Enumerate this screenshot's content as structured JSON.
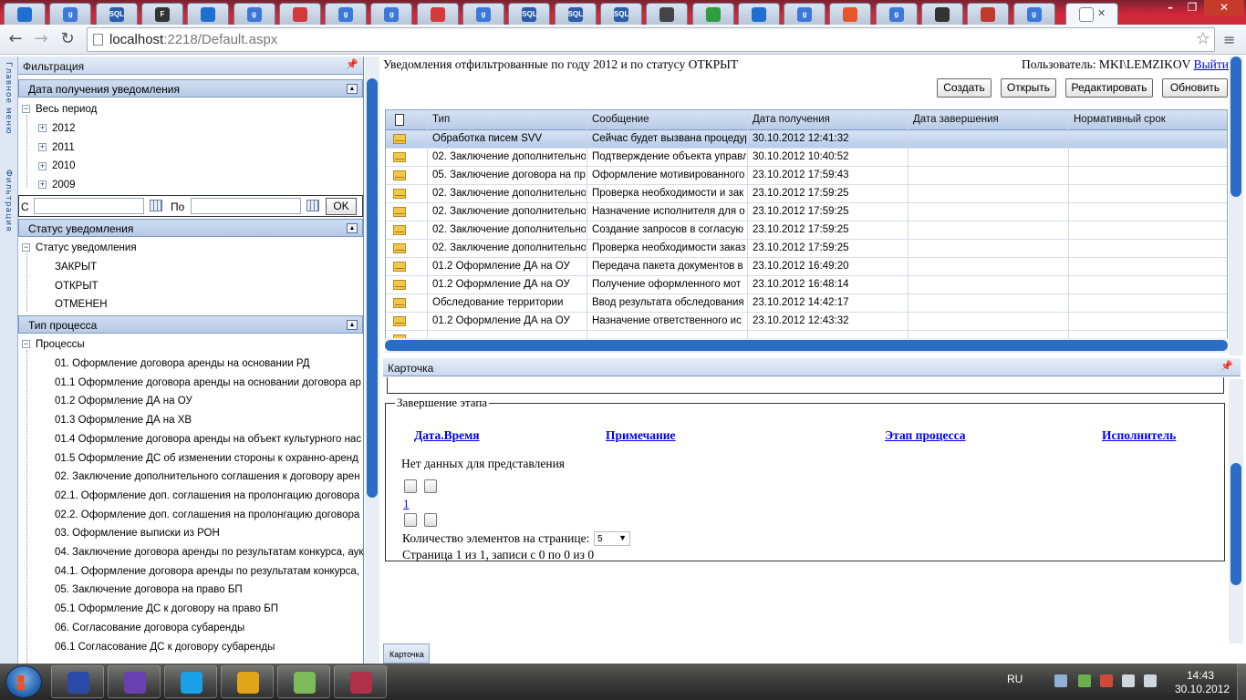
{
  "browser": {
    "tab_favicons": [
      {
        "icon": "app-icon",
        "color": "#1e6fd0",
        "label": ""
      },
      {
        "icon": "google-icon",
        "color": "#3c78d8",
        "label": "g"
      },
      {
        "icon": "sql-icon",
        "color": "#2a5ea8",
        "label": "SQL"
      },
      {
        "icon": "f-icon",
        "color": "#333333",
        "label": "F"
      },
      {
        "icon": "app-icon",
        "color": "#1e6fd0",
        "label": ""
      },
      {
        "icon": "google-icon",
        "color": "#3c78d8",
        "label": "g"
      },
      {
        "icon": "app-icon",
        "color": "#d43a3a",
        "label": ""
      },
      {
        "icon": "google-icon",
        "color": "#3c78d8",
        "label": "g"
      },
      {
        "icon": "google-icon",
        "color": "#3c78d8",
        "label": "g"
      },
      {
        "icon": "app-icon",
        "color": "#d43a3a",
        "label": ""
      },
      {
        "icon": "google-icon",
        "color": "#3c78d8",
        "label": "g"
      },
      {
        "icon": "sql-icon",
        "color": "#2a5ea8",
        "label": "SQL"
      },
      {
        "icon": "sql-icon",
        "color": "#2a5ea8",
        "label": "SQL"
      },
      {
        "icon": "sql-icon",
        "color": "#2a5ea8",
        "label": "SQL"
      },
      {
        "icon": "app-icon",
        "color": "#444444",
        "label": ""
      },
      {
        "icon": "app-icon",
        "color": "#2e9e3e",
        "label": ""
      },
      {
        "icon": "app-icon",
        "color": "#1e6fd0",
        "label": ""
      },
      {
        "icon": "google-icon",
        "color": "#3c78d8",
        "label": "g"
      },
      {
        "icon": "windows-icon",
        "color": "#e8542b",
        "label": ""
      },
      {
        "icon": "google-icon",
        "color": "#3c78d8",
        "label": "g"
      },
      {
        "icon": "app-icon",
        "color": "#333333",
        "label": ""
      },
      {
        "icon": "app-icon",
        "color": "#c0392b",
        "label": ""
      },
      {
        "icon": "google-icon",
        "color": "#3c78d8",
        "label": "g"
      },
      {
        "icon": "page-icon",
        "color": "#ffffff",
        "label": ""
      }
    ],
    "url_host": "localhost",
    "url_rest": ":2218/Default.aspx"
  },
  "sidebar_strip": {
    "main_menu": "Главное меню",
    "filtration": "Фильтрация"
  },
  "left": {
    "title": "Фильтрация",
    "date_group": {
      "title": "Дата получения уведомления",
      "root": "Весь период",
      "years": [
        "2012",
        "2011",
        "2010",
        "2009"
      ],
      "from_label": "С",
      "to_label": "По",
      "ok_label": "OK"
    },
    "status_group": {
      "title": "Статус уведомления",
      "root": "Статус уведомления",
      "items": [
        "ЗАКРЫТ",
        "ОТКРЫТ",
        "ОТМЕНЕН"
      ]
    },
    "process_group": {
      "title": "Тип процесса",
      "root": "Процессы",
      "items": [
        "01. Оформление договора аренды на основании РД",
        "01.1 Оформление договора аренды на основании договора ар",
        "01.2 Оформление ДА на ОУ",
        "01.3 Оформление ДА на ХВ",
        "01.4 Оформление договора аренды на объект культурного нас",
        "01.5 Оформление ДС об изменении стороны к охранно-аренд",
        "02. Заключение дополнительного соглашения к договору арен",
        "02.1. Оформление доп. соглашения на пролонгацию договора",
        "02.2. Оформление доп. соглашения на пролонгацию договора",
        "03. Оформление выписки из РОН",
        "04. Заключение договора аренды по результатам конкурса, аук",
        "04.1. Оформление договора аренды по результатам конкурса,",
        "05. Заключение договора на право БП",
        "05.1 Оформление ДС к договору на право БП",
        "06. Согласование договора субаренды",
        "06.1 Согласование ДС к договору субаренды"
      ]
    }
  },
  "main": {
    "heading": "Уведомления отфильтрованные по году 2012 и по статусу ОТКРЫТ",
    "user_label": "Пользователь: MKI\\LEMZIKOV",
    "logout": "Выйти",
    "buttons": {
      "create": "Создать",
      "open": "Открыть",
      "edit": "Редактировать",
      "refresh": "Обновить"
    },
    "columns": [
      "Тип",
      "Сообщение",
      "Дата получения",
      "Дата завершения",
      "Нормативный срок"
    ],
    "rows": [
      {
        "type": "Обработка писем SVV",
        "message": "Сейчас будет вызвана процедур",
        "received": "30.10.2012 12:41:32",
        "selected": true
      },
      {
        "type": "02. Заключение дополнительно",
        "message": "Подтверждение объекта управл",
        "received": "30.10.2012 10:40:52"
      },
      {
        "type": "05. Заключение договора на пр",
        "message": "Оформление мотивированного",
        "received": "23.10.2012 17:59:43"
      },
      {
        "type": "02. Заключение дополнительно",
        "message": "Проверка необходимости и зак",
        "received": "23.10.2012 17:59:25"
      },
      {
        "type": "02. Заключение дополнительно",
        "message": "Назначение исполнителя для о",
        "received": "23.10.2012 17:59:25"
      },
      {
        "type": "02. Заключение дополнительно",
        "message": "Создание запросов в согласую",
        "received": "23.10.2012 17:59:25"
      },
      {
        "type": "02. Заключение дополнительно",
        "message": "Проверка необходимости заказ",
        "received": "23.10.2012 17:59:25"
      },
      {
        "type": "01.2 Оформление ДА на ОУ",
        "message": "Передача пакета документов в",
        "received": "23.10.2012 16:49:20"
      },
      {
        "type": "01.2 Оформление ДА на ОУ",
        "message": "Получение оформленного мот",
        "received": "23.10.2012 16:48:14"
      },
      {
        "type": "Обследование территории",
        "message": "Ввод результата обследования",
        "received": "23.10.2012 14:42:17"
      },
      {
        "type": "01.2 Оформление ДА на ОУ",
        "message": "Назначение ответственного ис",
        "received": "23.10.2012 12:43:32"
      }
    ]
  },
  "card": {
    "title": "Карточка",
    "fieldset": "Завершение этапа",
    "headers": [
      "Дата.Время",
      "Примечание",
      "Этап процесса",
      "Исполнитель"
    ],
    "empty": "Нет данных для представления",
    "page_link": "1",
    "page_size_label": "Количество элементов на странице:",
    "page_size": "5",
    "page_info": "Страница 1 из 1, записи с 0 по 0 из 0",
    "bottom_tab": "Карточка"
  },
  "taskbar": {
    "apps": [
      {
        "name": "save-icon",
        "color": "#2a4aa8"
      },
      {
        "name": "visual-studio-icon",
        "color": "#6a3fb0"
      },
      {
        "name": "skype-icon",
        "color": "#1aa0e6"
      },
      {
        "name": "chrome-icon",
        "color": "#e2a51a"
      },
      {
        "name": "notepad-icon",
        "color": "#7dbb5a"
      },
      {
        "name": "sql-server-icon",
        "color": "#b0304a"
      }
    ],
    "lang": "RU",
    "time": "14:43",
    "date": "30.10.2012"
  },
  "colors": {
    "accent": "#2b6cc4",
    "link": "#0000ee",
    "header_grad": "#c9d8ee",
    "tab_bar": "#d6263a"
  }
}
